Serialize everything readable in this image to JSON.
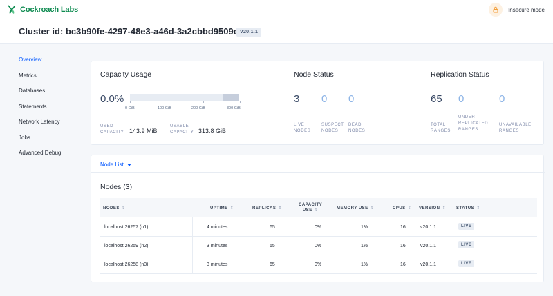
{
  "app": {
    "brand": "Cockroach Labs",
    "insecure_label": "Insecure mode"
  },
  "header": {
    "cluster_title": "Cluster id: bc3b90fe-4297-48e3-a46d-3a2cbbd9509d",
    "version": "V20.1.1"
  },
  "sidebar": {
    "items": [
      {
        "label": "Overview",
        "active": true
      },
      {
        "label": "Metrics"
      },
      {
        "label": "Databases"
      },
      {
        "label": "Statements"
      },
      {
        "label": "Network Latency"
      },
      {
        "label": "Jobs"
      },
      {
        "label": "Advanced Debug"
      }
    ]
  },
  "capacity": {
    "title": "Capacity Usage",
    "percent": "0.0%",
    "fraction_used": 0.0,
    "usable_fraction": 0.85,
    "tick_labels": [
      "0 GiB",
      "100 GiB",
      "200 GiB",
      "300 GiB"
    ],
    "used_label": [
      "USED",
      "CAPACITY"
    ],
    "used_value": "143.9 MiB",
    "usable_label": [
      "USABLE",
      "CAPACITY"
    ],
    "usable_value": "313.8 GiB"
  },
  "node_status": {
    "title": "Node Status",
    "live": "3",
    "suspect": "0",
    "dead": "0",
    "live_label": [
      "LIVE",
      "NODES"
    ],
    "suspect_label": [
      "SUSPECT",
      "NODES"
    ],
    "dead_label": [
      "DEAD",
      "NODES"
    ]
  },
  "replication": {
    "title": "Replication Status",
    "total": "65",
    "under": "0",
    "unavailable": "0",
    "total_label": [
      "TOTAL",
      "RANGES"
    ],
    "under_label": [
      "UNDER-",
      "REPLICATED",
      "RANGES"
    ],
    "unavailable_label": [
      "UNAVAILABLE",
      "RANGES"
    ]
  },
  "nodes": {
    "list_label": "Node List",
    "title": "Nodes (3)",
    "columns": [
      "NODES",
      "UPTIME",
      "REPLICAS",
      "CAPACITY",
      "USE",
      "MEMORY USE",
      "CPUS",
      "VERSION",
      "STATUS"
    ],
    "rows": [
      [
        "localhost:26257 (n1)",
        "4 minutes",
        "65",
        "0%",
        "1%",
        "16",
        "v20.1.1",
        "LIVE"
      ],
      [
        "localhost:26259 (n2)",
        "3 minutes",
        "65",
        "0%",
        "1%",
        "16",
        "v20.1.1",
        "LIVE"
      ],
      [
        "localhost:26258 (n3)",
        "3 minutes",
        "65",
        "0%",
        "1%",
        "16",
        "v20.1.1",
        "LIVE"
      ]
    ]
  },
  "colors": {
    "accent": "#0055ff",
    "brand": "#0c8a4f",
    "warning": "#f29c36"
  }
}
